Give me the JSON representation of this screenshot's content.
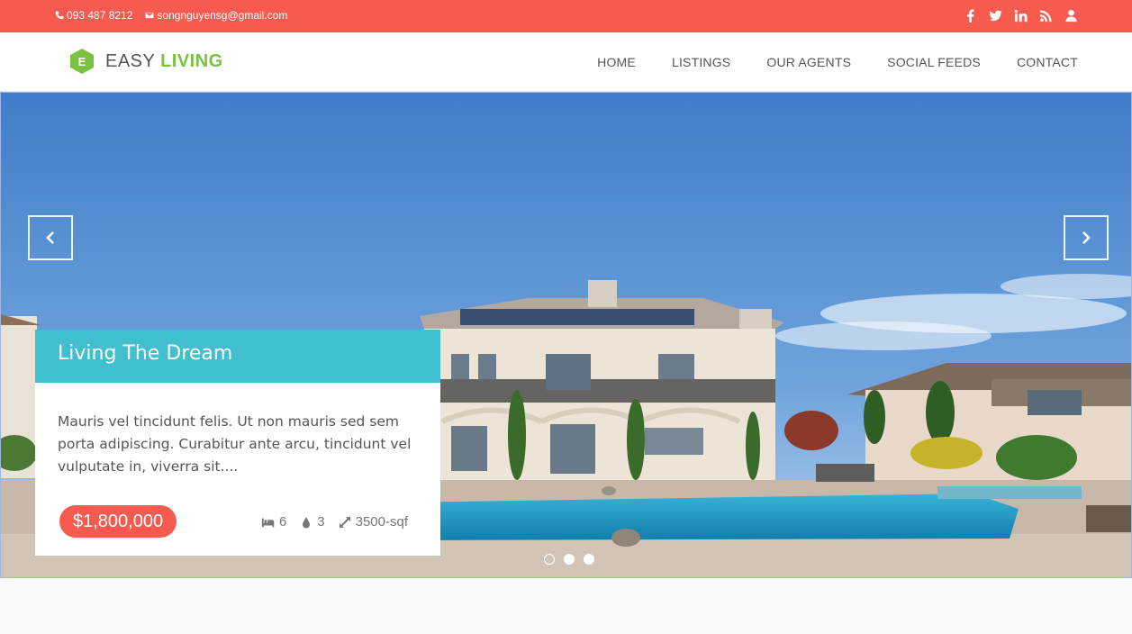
{
  "topbar": {
    "phone": "093 487 8212",
    "email": "songnguyensg@gmail.com",
    "social_icons": [
      "facebook-icon",
      "twitter-icon",
      "linkedin-icon",
      "rss-icon",
      "user-icon"
    ]
  },
  "brand": {
    "part1": "EASY ",
    "part2": "LIVING",
    "logo_letter": "E"
  },
  "nav": {
    "items": [
      {
        "label": "HOME"
      },
      {
        "label": "LISTINGS"
      },
      {
        "label": "OUR AGENTS"
      },
      {
        "label": "SOCIAL FEEDS"
      },
      {
        "label": "CONTACT"
      }
    ]
  },
  "slide": {
    "title": "Living The Dream",
    "description": "Mauris vel tincidunt felis. Ut non mauris sed sem porta adipiscing. Curabitur ante arcu, tincidunt vel vulputate in, viverra sit....",
    "price": "$1,800,000",
    "beds": "6",
    "baths": "3",
    "area": "3500-sqf",
    "active_dot": 0,
    "dot_count": 3
  },
  "colors": {
    "accent_red": "#f75a4f",
    "accent_teal": "#41bfcf",
    "brand_green": "#7cc242"
  }
}
